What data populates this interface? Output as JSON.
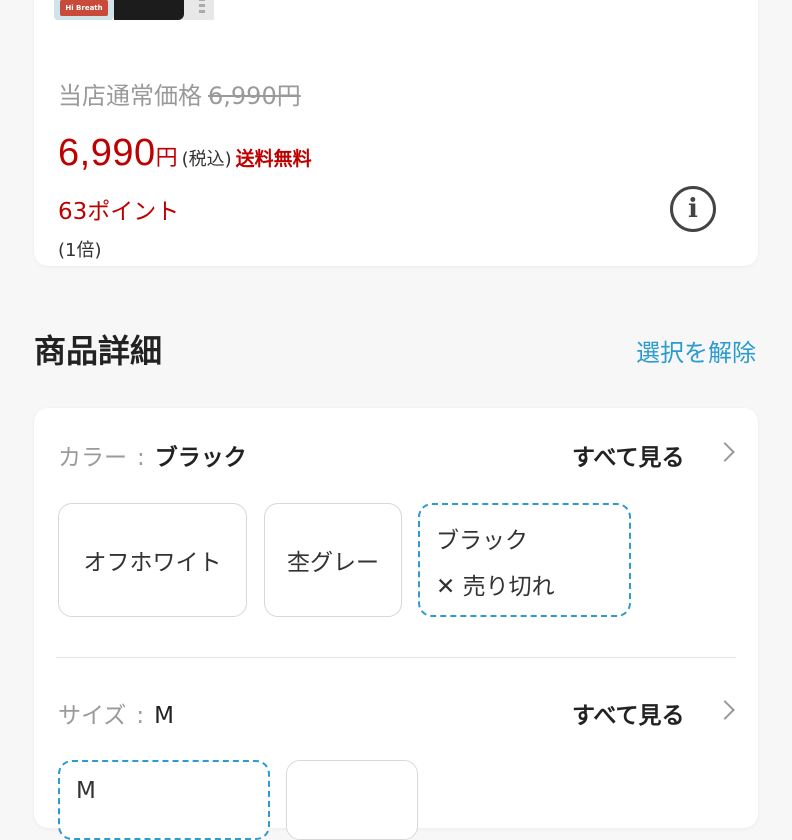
{
  "price_card": {
    "regular_label": "当店通常価格",
    "regular_price": "6,990円",
    "sale_price": "6,990",
    "yen": "円",
    "tax_note": "(税込)",
    "shipping": "送料無料",
    "points": "63ポイント",
    "multiplier": "(1倍)",
    "info_icon": "i"
  },
  "details": {
    "title": "商品詳細",
    "clear_selection": "選択を解除",
    "color": {
      "label": "カラー",
      "separator": ":",
      "value": "ブラック",
      "see_all": "すべて見る",
      "options": [
        {
          "name": "オフホワイト"
        },
        {
          "name": "杢グレー"
        },
        {
          "name": "ブラック",
          "status": "✕ 売り切れ"
        }
      ]
    },
    "size": {
      "label": "サイズ",
      "separator": ":",
      "value": "M",
      "see_all": "すべて見る",
      "options": [
        {
          "name": "M"
        },
        {
          "name": ""
        }
      ]
    }
  },
  "colors": {
    "accent_red": "#bf0000",
    "link_blue": "#2b9bd0",
    "selected_border": "#2b9bd0"
  }
}
